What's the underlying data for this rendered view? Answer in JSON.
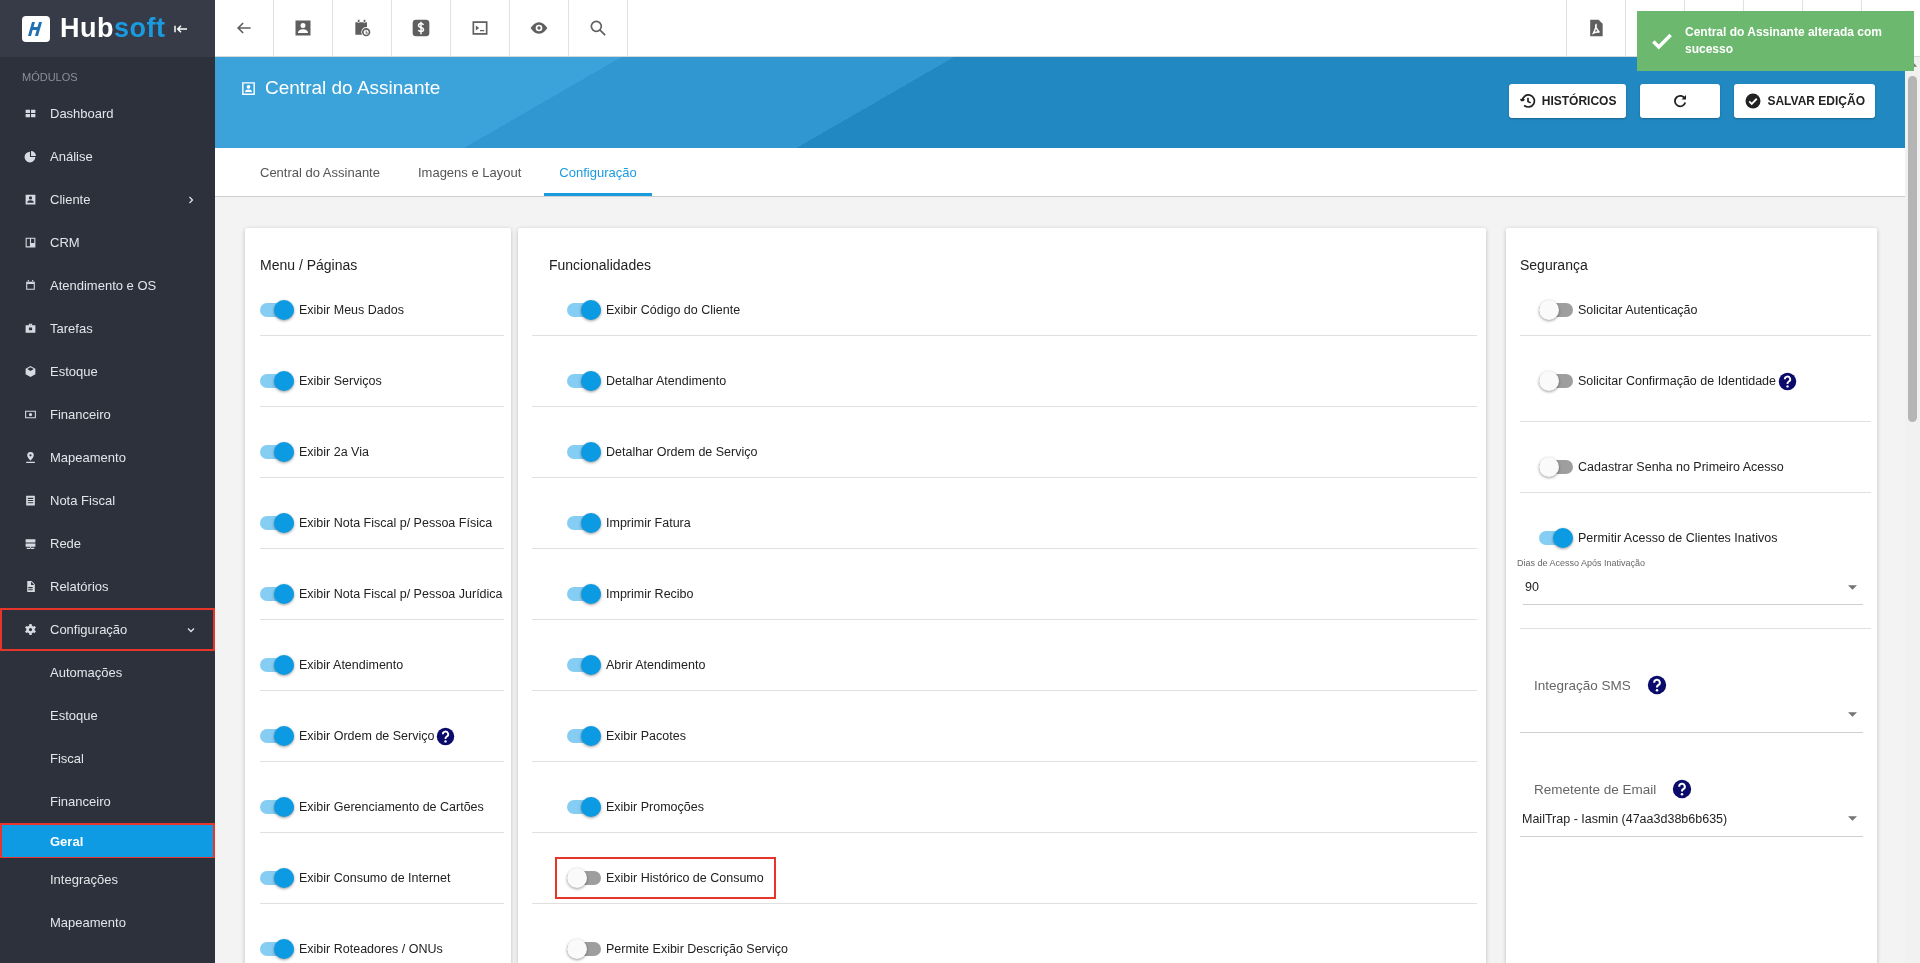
{
  "sidebar": {
    "logo": {
      "primary": "Hub",
      "accent": "soft"
    },
    "section": "MÓDULOS",
    "items": [
      {
        "label": "Dashboard",
        "kind": "link",
        "selected": false,
        "highlighted": false
      },
      {
        "label": "Análise",
        "kind": "link",
        "selected": false,
        "highlighted": false
      },
      {
        "label": "Cliente",
        "kind": "group",
        "expanded": false,
        "selected": false,
        "highlighted": false
      },
      {
        "label": "CRM",
        "kind": "link",
        "selected": false,
        "highlighted": false
      },
      {
        "label": "Atendimento e OS",
        "kind": "link",
        "selected": false,
        "highlighted": false
      },
      {
        "label": "Tarefas",
        "kind": "link",
        "selected": false,
        "highlighted": false
      },
      {
        "label": "Estoque",
        "kind": "link",
        "selected": false,
        "highlighted": false
      },
      {
        "label": "Financeiro",
        "kind": "link",
        "selected": false,
        "highlighted": false
      },
      {
        "label": "Mapeamento",
        "kind": "link",
        "selected": false,
        "highlighted": false
      },
      {
        "label": "Nota Fiscal",
        "kind": "link",
        "selected": false,
        "highlighted": false
      },
      {
        "label": "Rede",
        "kind": "link",
        "selected": false,
        "highlighted": false
      },
      {
        "label": "Relatórios",
        "kind": "link",
        "selected": false,
        "highlighted": false
      },
      {
        "label": "Configuração",
        "kind": "group",
        "expanded": true,
        "selected": false,
        "highlighted": true,
        "children": [
          {
            "label": "Automações",
            "selected": false,
            "highlighted": false
          },
          {
            "label": "Estoque",
            "selected": false,
            "highlighted": false
          },
          {
            "label": "Fiscal",
            "selected": false,
            "highlighted": false
          },
          {
            "label": "Financeiro",
            "selected": false,
            "highlighted": false
          },
          {
            "label": "Geral",
            "selected": true,
            "highlighted": true
          },
          {
            "label": "Integrações",
            "selected": false,
            "highlighted": false
          },
          {
            "label": "Mapeamento",
            "selected": false,
            "highlighted": false
          }
        ]
      }
    ]
  },
  "toast": {
    "message": "Central do Assinante alterada com sucesso"
  },
  "header": {
    "title": "Central do Assinante",
    "buttons": [
      {
        "kind": "history",
        "label": "HISTÓRICOS"
      },
      {
        "kind": "refresh"
      },
      {
        "kind": "save",
        "label": "SALVAR EDIÇÃO"
      }
    ]
  },
  "tabs": [
    {
      "label": "Central do Assinante",
      "selected": false
    },
    {
      "label": "Imagens e Layout",
      "selected": false
    },
    {
      "label": "Configuração",
      "selected": true
    }
  ],
  "menu_card": {
    "title": "Menu / Páginas",
    "items": [
      {
        "label": "Exibir Meus Dados",
        "on": true,
        "help": false
      },
      {
        "label": "Exibir Serviços",
        "on": true,
        "help": false
      },
      {
        "label": "Exibir 2a Via",
        "on": true,
        "help": false
      },
      {
        "label": "Exibir Nota Fiscal p/ Pessoa Física",
        "on": true,
        "help": false
      },
      {
        "label": "Exibir Nota Fiscal p/ Pessoa Jurídica",
        "on": true,
        "help": false
      },
      {
        "label": "Exibir Atendimento",
        "on": true,
        "help": false
      },
      {
        "label": "Exibir Ordem de Serviço",
        "on": true,
        "help": true
      },
      {
        "label": "Exibir Gerenciamento de Cartões",
        "on": true,
        "help": false
      },
      {
        "label": "Exibir Consumo de Internet",
        "on": true,
        "help": false
      },
      {
        "label": "Exibir Roteadores / ONUs",
        "on": true,
        "help": false
      }
    ]
  },
  "features_card": {
    "title": "Funcionalidades",
    "items": [
      {
        "label": "Exibir Código do Cliente",
        "on": true,
        "highlighted": false
      },
      {
        "label": "Detalhar Atendimento",
        "on": true,
        "highlighted": false
      },
      {
        "label": "Detalhar Ordem de Serviço",
        "on": true,
        "highlighted": false
      },
      {
        "label": "Imprimir Fatura",
        "on": true,
        "highlighted": false
      },
      {
        "label": "Imprimir Recibo",
        "on": true,
        "highlighted": false
      },
      {
        "label": "Abrir Atendimento",
        "on": true,
        "highlighted": false
      },
      {
        "label": "Exibir Pacotes",
        "on": true,
        "highlighted": false
      },
      {
        "label": "Exibir Promoções",
        "on": true,
        "highlighted": false
      },
      {
        "label": "Exibir Histórico de Consumo",
        "on": false,
        "highlighted": true
      },
      {
        "label": "Permite Exibir Descrição Serviço",
        "on": false,
        "highlighted": false
      }
    ]
  },
  "security_card": {
    "title": "Segurança",
    "rows": [
      {
        "kind": "toggle",
        "label": "Solicitar Autenticação",
        "on": false
      },
      {
        "kind": "toggle",
        "label": "Solicitar Confirmação de Identidade",
        "on": false,
        "help": true
      },
      {
        "kind": "toggle",
        "label": "Cadastrar Senha no Primeiro Acesso",
        "on": false
      },
      {
        "kind": "toggle",
        "label": "Permitir Acesso de Clientes Inativos",
        "on": true,
        "field": {
          "label": "Dias de Acesso Após Inativação",
          "value": "90"
        }
      },
      {
        "kind": "select",
        "label": "Integração SMS",
        "help": true
      },
      {
        "kind": "select",
        "label": "Remetente de Email",
        "help": true,
        "value": "MailTrap - Iasmin (47aa3d38b6b635)"
      }
    ]
  }
}
